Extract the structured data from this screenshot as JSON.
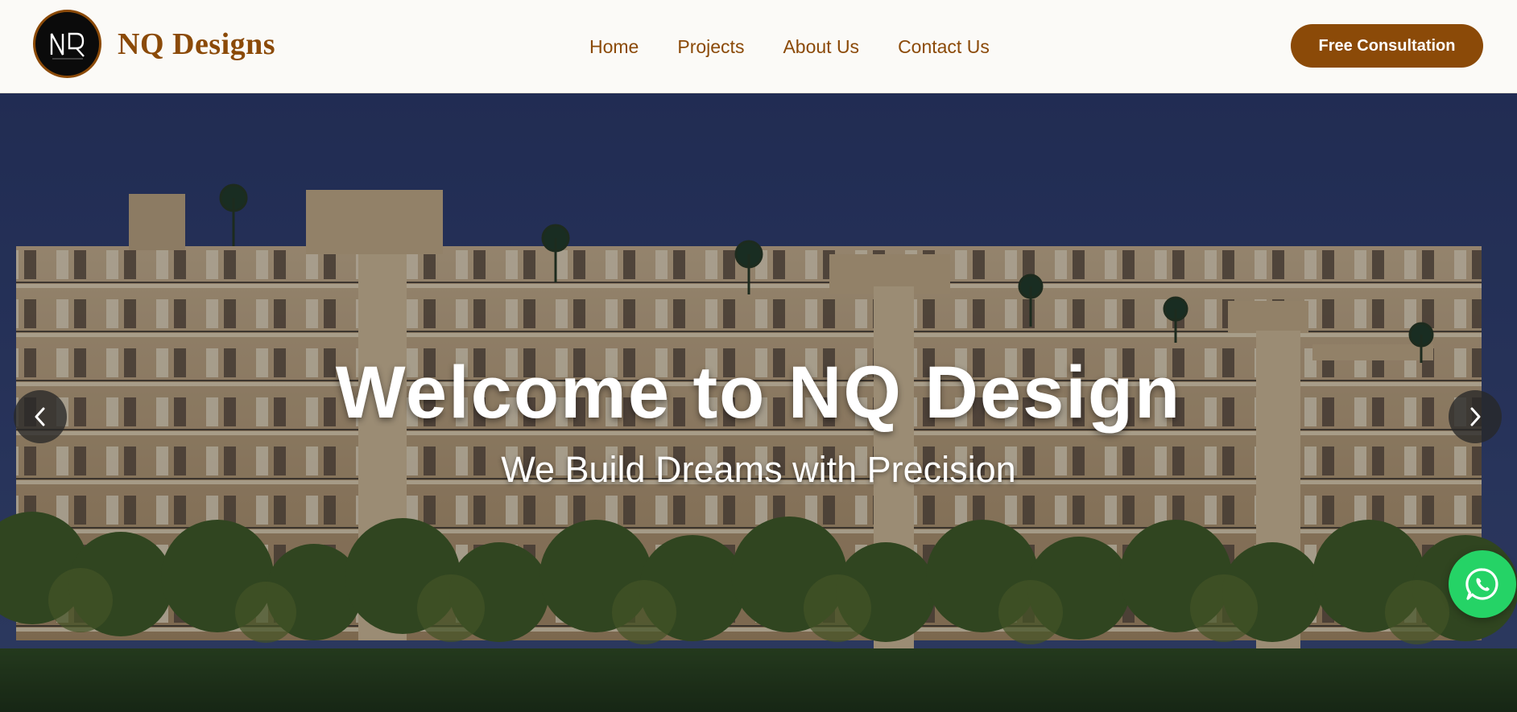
{
  "brand": {
    "logo_monogram": "NQ",
    "name": "NQ Designs",
    "logo_icon": "nq-monogram-logo"
  },
  "nav": {
    "items": [
      {
        "label": "Home"
      },
      {
        "label": "Projects"
      },
      {
        "label": "About Us"
      },
      {
        "label": "Contact Us"
      }
    ],
    "cta_label": "Free Consultation"
  },
  "hero": {
    "title": "Welcome to NQ Design",
    "subtitle": "We Build Dreams with Precision",
    "prev_icon": "chevron-left-icon",
    "next_icon": "chevron-right-icon",
    "image": "apartment-building-at-night"
  },
  "floating": {
    "icon": "whatsapp-icon"
  },
  "colors": {
    "brand": "#8b4a08",
    "whatsapp": "#25d366",
    "sky": "#2b3a6b"
  }
}
